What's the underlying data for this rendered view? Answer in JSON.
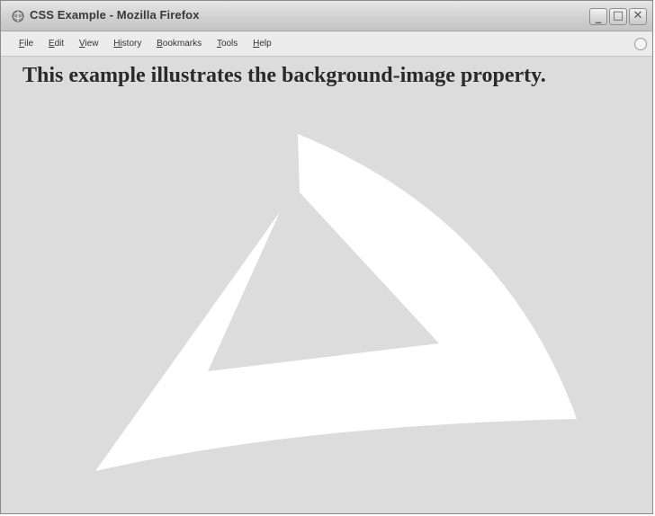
{
  "window": {
    "title": "CSS Example - Mozilla Firefox"
  },
  "title_buttons": {
    "minimize": "_",
    "maximize": "□",
    "close": "✕"
  },
  "menubar": {
    "items": [
      {
        "accel": "F",
        "rest": "ile"
      },
      {
        "accel": "E",
        "rest": "dit"
      },
      {
        "accel": "V",
        "rest": "iew"
      },
      {
        "accel": "Hi",
        "rest": "story"
      },
      {
        "accel": "B",
        "rest": "ookmarks"
      },
      {
        "accel": "T",
        "rest": "ools"
      },
      {
        "accel": "H",
        "rest": "elp"
      }
    ]
  },
  "page": {
    "heading": "This example illustrates the background-image property."
  },
  "icons": {
    "app": "firefox-globe-icon",
    "throbber": "throbber-icon",
    "background": "triangle-swoosh-background-image"
  },
  "colors": {
    "page_background": "#dcdcdc",
    "background_shape": "#ffffff",
    "heading_text": "#2a2a2a"
  }
}
